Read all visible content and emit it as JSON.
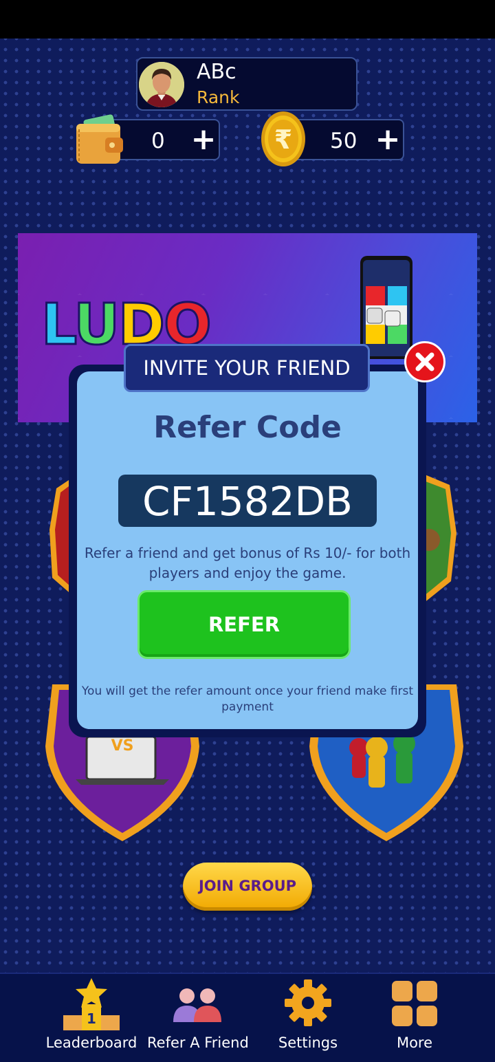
{
  "profile": {
    "name": "ABc",
    "rank": "Rank"
  },
  "wallet": {
    "value": "0",
    "add": "+"
  },
  "coins": {
    "value": "50",
    "add": "+"
  },
  "banner": {
    "logo": [
      "L",
      "U",
      "D",
      "O"
    ]
  },
  "modal": {
    "header": "INVITE YOUR FRIEND",
    "title": "Refer Code",
    "code": "CF1582DB",
    "description": "Refer a friend and get bonus of Rs 10/- for both players and enjoy the game.",
    "button": "REFER",
    "note": "You will get the refer amount once your friend make first payment"
  },
  "join_group": "JOIN GROUP",
  "nav": [
    {
      "label": "Leaderboard",
      "icon": "leaderboard-icon"
    },
    {
      "label": "Refer A Friend",
      "icon": "refer-friend-icon"
    },
    {
      "label": "Settings",
      "icon": "gear-icon"
    },
    {
      "label": "More",
      "icon": "more-grid-icon"
    }
  ],
  "colors": {
    "background": "#0f1c5c",
    "modal": "#88c4f5",
    "refer_button": "#1ec21e",
    "close": "#e5141b",
    "rank": "#f6b93b"
  }
}
